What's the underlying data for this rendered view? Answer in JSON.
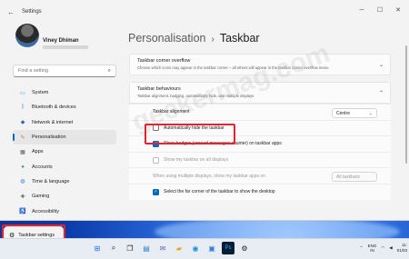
{
  "window": {
    "title": "Settings"
  },
  "user": {
    "name": "Viney Dhiman"
  },
  "sidebar": {
    "search_placeholder": "Find a setting",
    "items": [
      {
        "label": "System",
        "icon": "monitor-icon",
        "active": false
      },
      {
        "label": "Bluetooth & devices",
        "icon": "bluetooth-icon",
        "active": false
      },
      {
        "label": "Network & internet",
        "icon": "network-icon",
        "active": false
      },
      {
        "label": "Personalisation",
        "icon": "brush-icon",
        "active": true
      },
      {
        "label": "Apps",
        "icon": "apps-icon",
        "active": false
      },
      {
        "label": "Accounts",
        "icon": "person-icon",
        "active": false
      },
      {
        "label": "Time & language",
        "icon": "globe-icon",
        "active": false
      },
      {
        "label": "Gaming",
        "icon": "gamepad-icon",
        "active": false
      },
      {
        "label": "Accessibility",
        "icon": "accessibility-icon",
        "active": false
      }
    ]
  },
  "header": {
    "crumb": "Personalisation",
    "separator": "›",
    "title": "Taskbar"
  },
  "cards": {
    "overflow": {
      "title": "Taskbar corner overflow",
      "subtitle": "Choose which icons may appear in the taskbar corner – all others will appear in the taskbar corner overflow menu"
    },
    "behaviours": {
      "title": "Taskbar behaviours",
      "subtitle": "Taskbar alignment, badging, automatically hide, and multiple displays"
    }
  },
  "behaviours": {
    "alignment_label": "Taskbar alignment",
    "alignment_value": "Centre",
    "auto_hide_label": "Automatically hide the taskbar",
    "badges_label": "Show badges (unread messages counter) on taskbar apps",
    "all_displays_label": "Show my taskbar on all displays",
    "multi_label": "When using multiple displays, show my taskbar apps on",
    "multi_value": "All taskbars",
    "far_corner_label": "Select the far corner of the taskbar to show the desktop"
  },
  "watermark": "geekermag.com",
  "taskbar_settings_label": "Taskbar settings",
  "tray": {
    "lang1": "ENG",
    "lang2": "IN",
    "time": "11:",
    "date": "01/03"
  },
  "colors": {
    "accent": "#0067c0",
    "highlight": "#e0252f"
  }
}
